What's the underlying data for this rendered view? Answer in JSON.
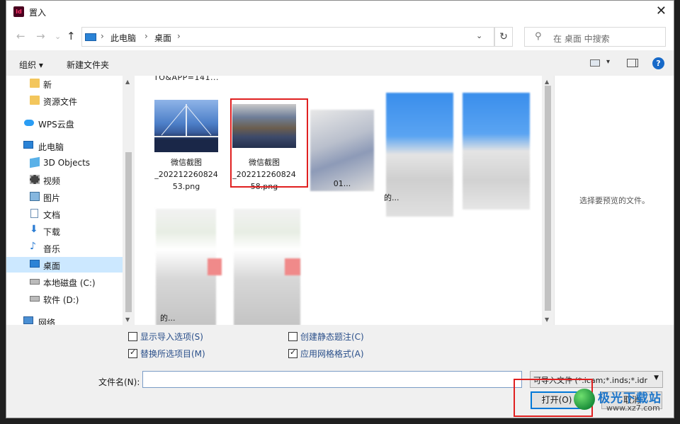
{
  "window": {
    "app_icon_text": "Id",
    "title": "置入",
    "close_label": "✕"
  },
  "nav": {
    "back": "←",
    "forward": "→",
    "recent": "⌄",
    "up": "↑",
    "breadcrumb": [
      "此电脑",
      "桌面"
    ],
    "breadcrumb_sep": "›",
    "address_dropdown": "⌄",
    "refresh": "↻",
    "search_placeholder": "在 桌面 中搜索",
    "search_icon": "⚲"
  },
  "toolbar": {
    "organize": "组织 ▾",
    "new_folder": "新建文件夹",
    "help": "?",
    "view_dropdown": "▾"
  },
  "sidebar": {
    "items": [
      {
        "label": "新",
        "icon": "folder-icon"
      },
      {
        "label": "资源文件",
        "icon": "folder-icon"
      },
      {
        "label": "WPS云盘",
        "icon": "cloud-icon"
      },
      {
        "label": "此电脑",
        "icon": "computer-icon"
      },
      {
        "label": "3D Objects",
        "icon": "cube-icon"
      },
      {
        "label": "视频",
        "icon": "video-icon"
      },
      {
        "label": "图片",
        "icon": "picture-icon"
      },
      {
        "label": "文档",
        "icon": "document-icon"
      },
      {
        "label": "下载",
        "icon": "download-icon"
      },
      {
        "label": "音乐",
        "icon": "music-icon"
      },
      {
        "label": "桌面",
        "icon": "desktop-icon",
        "selected": true
      },
      {
        "label": "本地磁盘 (C:)",
        "icon": "drive-icon"
      },
      {
        "label": "软件 (D:)",
        "icon": "drive-icon"
      },
      {
        "label": "网络",
        "icon": "network-icon"
      }
    ]
  },
  "files": {
    "clipped_label": "TO&APP=141...",
    "items": [
      {
        "line1": "微信截图",
        "line2": "_202212260824",
        "line3": "53.png"
      },
      {
        "line1": "微信截图",
        "line2": "_202212260824",
        "line3": "58.png"
      },
      {
        "line1": "01..."
      },
      {
        "line1": "的..."
      },
      {
        "line1": "的..."
      }
    ]
  },
  "preview": {
    "message": "选择要预览的文件。"
  },
  "options": {
    "show_import_options": {
      "label": "显示导入选项(S)",
      "checked": false
    },
    "replace_selected": {
      "label": "替换所选项目(M)",
      "checked": true
    },
    "create_static_caption": {
      "label": "创建静态题注(C)",
      "checked": false
    },
    "apply_grid": {
      "label": "应用网格格式(A)",
      "checked": true
    }
  },
  "filename": {
    "label": "文件名(N):",
    "value": ""
  },
  "filetype": {
    "selected": "可导入文件 (*.icam;*.inds;*.idr"
  },
  "buttons": {
    "open": "打开(O)",
    "cancel": "取消"
  },
  "watermark": {
    "brand": "极光下载站",
    "url": "www.xz7.com"
  },
  "colors": {
    "selection": "#cce8ff",
    "highlight_box": "#e02020",
    "accent": "#0078d7",
    "link_text": "#2a4f8a"
  }
}
